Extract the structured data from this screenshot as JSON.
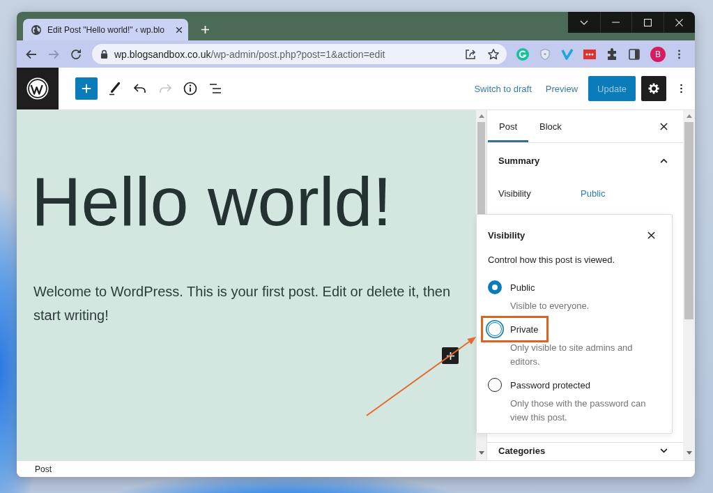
{
  "browser": {
    "tabs": [
      {
        "title": "Edit Post \"Hello world!\" ‹ wp.blo",
        "selected": true
      }
    ],
    "navigation": {
      "back": {
        "disabled": false
      },
      "forward": {
        "disabled": true
      }
    },
    "address_bar": {
      "host": "wp.blogsandbox.co.uk",
      "path": "/wp-admin/post.php?post=1&action=edit"
    },
    "profile": {
      "initial": "B"
    }
  },
  "editor_header": {
    "history": {
      "undo": {
        "disabled": false
      },
      "redo": {
        "disabled": true
      }
    },
    "links": [
      {
        "label": "Switch to draft"
      },
      {
        "label": "Preview"
      }
    ],
    "update_button": {
      "label": "Update",
      "disabled": true
    },
    "settings": {
      "pressed": true
    }
  },
  "post": {
    "title": "Hello world!",
    "paragraph": "Welcome to WordPress. This is your first post. Edit or delete it, then start writing!"
  },
  "sidebar": {
    "tabs": [
      {
        "label": "Post",
        "selected": true
      },
      {
        "label": "Block",
        "selected": false
      }
    ],
    "panels": [
      {
        "title": "Summary",
        "expanded": true,
        "rows": [
          {
            "label": "Visibility",
            "value": "Public"
          }
        ]
      },
      {
        "title": "Categories",
        "expanded": false
      }
    ]
  },
  "visibility_popover": {
    "title": "Visibility",
    "intro": "Control how this post is viewed.",
    "options": [
      {
        "label": "Public",
        "description": "Visible to everyone.",
        "selected": true,
        "focused": false,
        "highlighted": false
      },
      {
        "label": "Private",
        "description": "Only visible to site admins and editors.",
        "selected": false,
        "focused": true,
        "highlighted": true
      },
      {
        "label": "Password protected",
        "description": "Only those with the password can view this post.",
        "selected": false,
        "focused": false,
        "highlighted": false
      }
    ]
  },
  "status_bar": {
    "breadcrumb": "Post"
  }
}
